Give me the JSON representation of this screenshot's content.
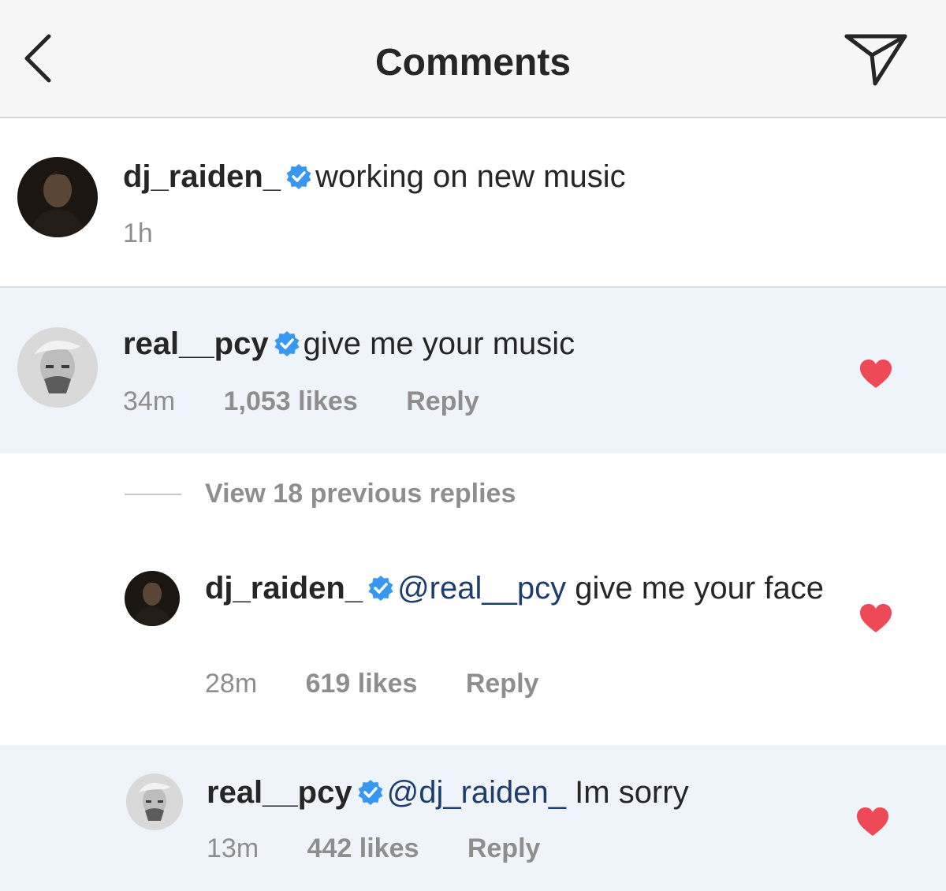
{
  "header": {
    "title": "Comments",
    "back_icon": "chevron-left-icon",
    "send_icon": "paper-plane-icon"
  },
  "caption": {
    "username": "dj_raiden_",
    "text": "working on new music",
    "time": "1h"
  },
  "comments": [
    {
      "username": "real__pcy",
      "text": "give me your music",
      "time": "34m",
      "likes": "1,053 likes",
      "reply": "Reply",
      "liked": true
    }
  ],
  "view_replies": "View 18 previous replies",
  "replies": [
    {
      "username": "dj_raiden_",
      "mention": "@real__pcy",
      "text": "give me your face",
      "time": "28m",
      "likes": "619 likes",
      "reply": "Reply",
      "liked": true
    },
    {
      "username": "real__pcy",
      "mention": "@dj_raiden_",
      "text": "Im sorry",
      "time": "13m",
      "likes": "442 likes",
      "reply": "Reply",
      "liked": true
    }
  ],
  "colors": {
    "verified_blue": "#3897f0",
    "heart_red": "#ed4956",
    "mention_navy": "#1e3d6e",
    "highlight_bg": "#eff4fb",
    "meta_gray": "#8e8e8e"
  }
}
